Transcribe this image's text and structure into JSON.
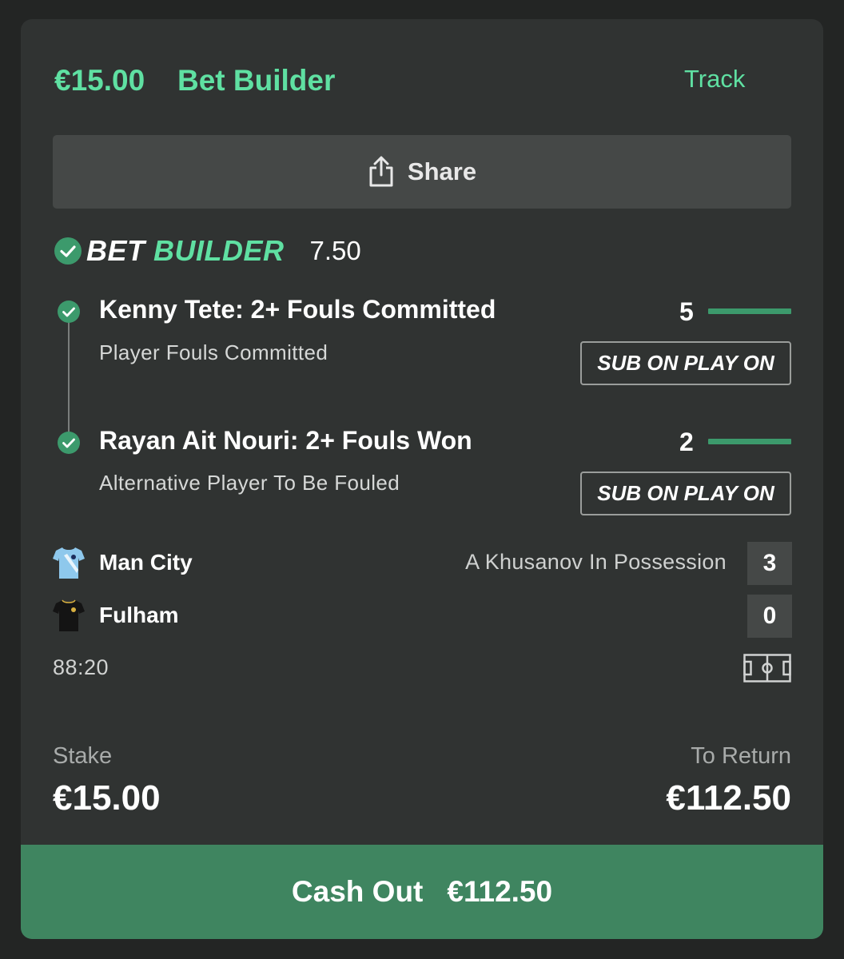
{
  "header": {
    "stake_amount": "€15.00",
    "bet_type": "Bet Builder",
    "track_label": "Track"
  },
  "share": {
    "label": "Share",
    "icon": "share-icon"
  },
  "bet_builder": {
    "logo_part1": "BET",
    "logo_part2": "BUILDER",
    "odds": "7.50"
  },
  "legs": [
    {
      "title": "Kenny Tete: 2+ Fouls Committed",
      "subtitle": "Player Fouls Committed",
      "count": "5",
      "progress": 1.0,
      "sub_button": "SUB ON PLAY ON"
    },
    {
      "title": "Rayan Ait Nouri: 2+ Fouls Won",
      "subtitle": "Alternative Player To Be Fouled",
      "count": "2",
      "progress": 1.0,
      "sub_button": "SUB ON PLAY ON"
    }
  ],
  "match": {
    "home_team": "Man City",
    "away_team": "Fulham",
    "possession_text": "A Khusanov In Possession",
    "home_score": "3",
    "away_score": "0",
    "clock": "88:20"
  },
  "totals": {
    "stake_label": "Stake",
    "stake_value": "€15.00",
    "return_label": "To Return",
    "return_value": "€112.50"
  },
  "cashout": {
    "label": "Cash Out",
    "amount": "€112.50"
  },
  "colors": {
    "accent": "#5fe0a2",
    "cashout_bg": "#3f8560",
    "card_bg": "#303332",
    "page_bg": "#232524"
  }
}
